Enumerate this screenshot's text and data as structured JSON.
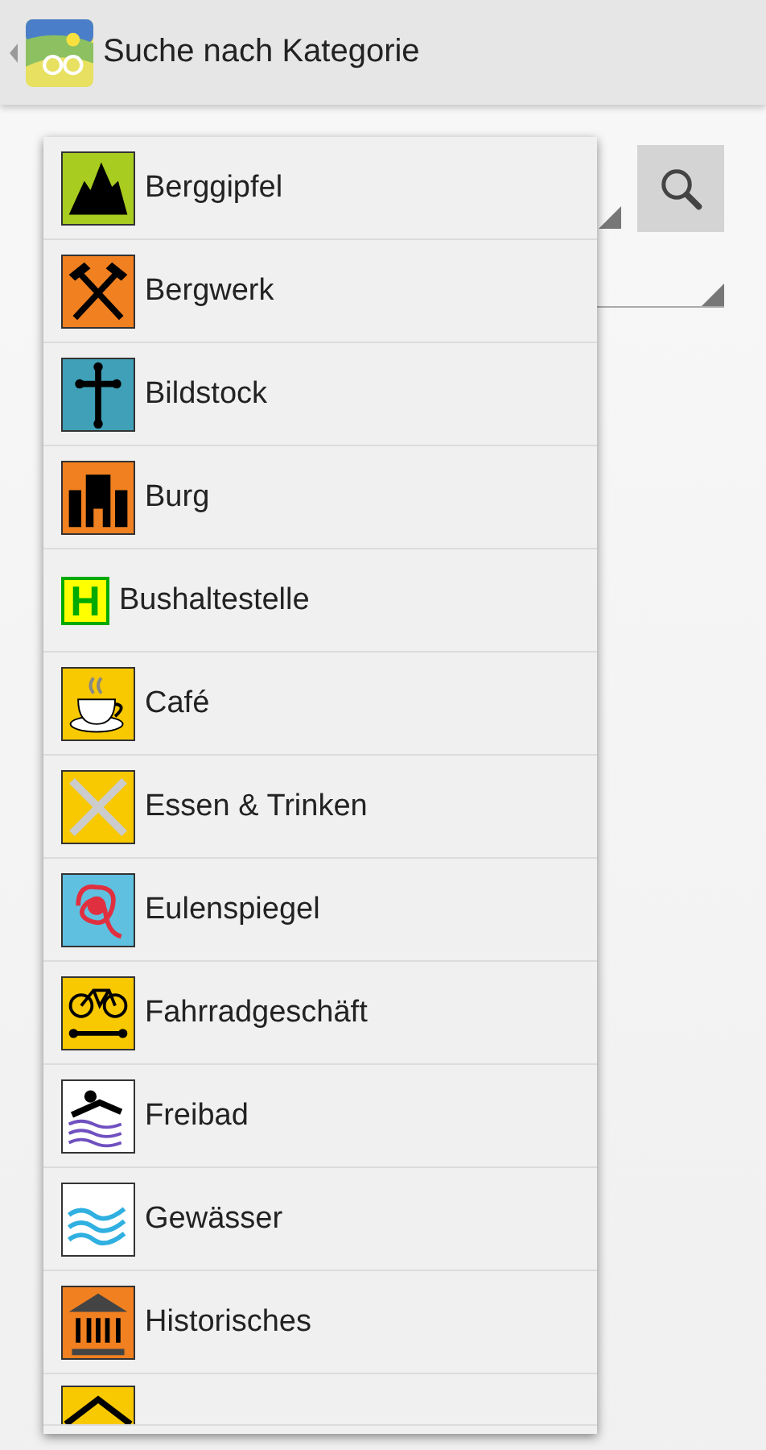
{
  "header": {
    "title": "Suche nach Kategorie"
  },
  "dropdown": {
    "items": [
      {
        "kind": "mountain",
        "label": "Berggipfel"
      },
      {
        "kind": "hammers",
        "label": "Bergwerk"
      },
      {
        "kind": "cross",
        "label": "Bildstock"
      },
      {
        "kind": "castle",
        "label": "Burg"
      },
      {
        "kind": "letter",
        "icon_text": "H",
        "label": "Bushaltestelle"
      },
      {
        "kind": "cup",
        "label": "Café"
      },
      {
        "kind": "cutlery",
        "label": "Essen & Trinken"
      },
      {
        "kind": "knot",
        "label": "Eulenspiegel"
      },
      {
        "kind": "bicycle",
        "label": "Fahrradgeschäft"
      },
      {
        "kind": "swimmer",
        "label": "Freibad"
      },
      {
        "kind": "waves",
        "label": "Gewässer"
      },
      {
        "kind": "temple",
        "label": "Historisches"
      },
      {
        "kind": "roof"
      }
    ]
  }
}
